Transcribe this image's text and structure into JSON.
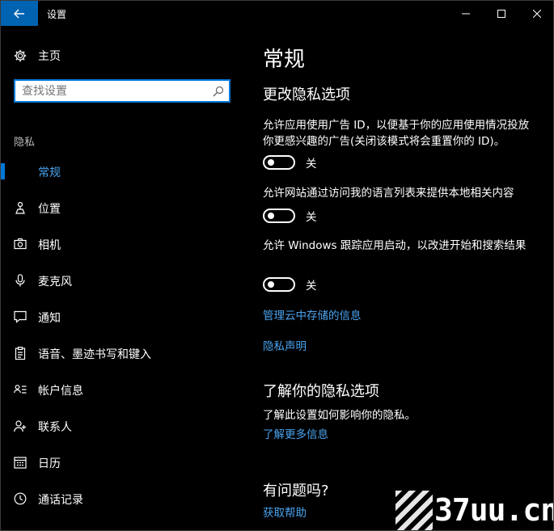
{
  "window": {
    "title": "设置"
  },
  "sidebar": {
    "home_label": "主页",
    "search_placeholder": "查找设置",
    "section_header": "隐私",
    "items": [
      {
        "label": "常规",
        "icon": "lock-icon",
        "selected": true
      },
      {
        "label": "位置",
        "icon": "location-icon"
      },
      {
        "label": "相机",
        "icon": "camera-icon"
      },
      {
        "label": "麦克风",
        "icon": "microphone-icon"
      },
      {
        "label": "通知",
        "icon": "notification-icon"
      },
      {
        "label": "语音、墨迹书写和键入",
        "icon": "clipboard-icon"
      },
      {
        "label": "帐户信息",
        "icon": "account-info-icon"
      },
      {
        "label": "联系人",
        "icon": "contacts-icon"
      },
      {
        "label": "日历",
        "icon": "calendar-icon"
      },
      {
        "label": "通话记录",
        "icon": "call-history-icon"
      }
    ]
  },
  "main": {
    "title": "常规",
    "section1_heading": "更改隐私选项",
    "options": [
      {
        "description": "允许应用使用广告 ID，以便基于你的应用使用情况投放你更感兴趣的广告(关闭该模式将会重置你的 ID)。",
        "state_label": "关"
      },
      {
        "description": "允许网站通过访问我的语言列表来提供本地相关内容",
        "state_label": "关"
      },
      {
        "description": "允许 Windows 跟踪应用启动，以改进开始和搜索结果",
        "state_label": "关"
      }
    ],
    "link_manage_cloud": "管理云中存储的信息",
    "link_privacy_statement": "隐私声明",
    "section2_heading": "了解你的隐私选项",
    "section2_text": "了解此设置如何影响你的隐私。",
    "section2_link": "了解更多信息",
    "section3_heading": "有问题吗?",
    "section3_link": "获取帮助"
  },
  "watermark": {
    "text": "37uu.cn"
  },
  "colors": {
    "accent": "#0078d7",
    "link": "#4aa3f0",
    "titlebar_back": "#0063b1",
    "background": "#000000"
  }
}
